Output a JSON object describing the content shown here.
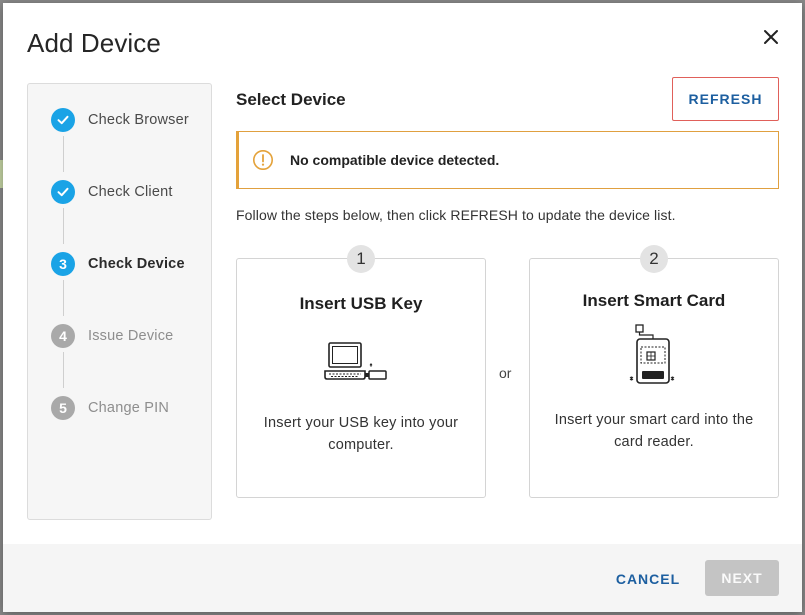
{
  "dialog": {
    "title": "Add Device"
  },
  "stepper": {
    "steps": [
      {
        "number": "1",
        "label": "Check Browser",
        "status": "done"
      },
      {
        "number": "2",
        "label": "Check Client",
        "status": "done"
      },
      {
        "number": "3",
        "label": "Check Device",
        "status": "active"
      },
      {
        "number": "4",
        "label": "Issue Device",
        "status": "pending"
      },
      {
        "number": "5",
        "label": "Change PIN",
        "status": "pending"
      }
    ]
  },
  "main": {
    "section_title": "Select Device",
    "refresh_label": "REFRESH",
    "alert_text": "No compatible device detected.",
    "instructions": "Follow the steps below, then click REFRESH to update the device list.",
    "or_label": "or",
    "cards": [
      {
        "number": "1",
        "title": "Insert USB Key",
        "desc_line1": "Insert your USB key into your",
        "desc_line2": "computer.",
        "icon": "laptop-usb-icon"
      },
      {
        "number": "2",
        "title": "Insert Smart Card",
        "desc_line1": "Insert your smart card into the",
        "desc_line2": "card reader.",
        "icon": "smart-card-reader-icon"
      }
    ]
  },
  "footer": {
    "cancel_label": "CANCEL",
    "next_label": "NEXT"
  },
  "colors": {
    "accent": "#1aa3e6",
    "link": "#1d5fa0",
    "warning": "#e4a23a",
    "focus_outline": "#e0605a",
    "disabled": "#c4c4c4"
  }
}
